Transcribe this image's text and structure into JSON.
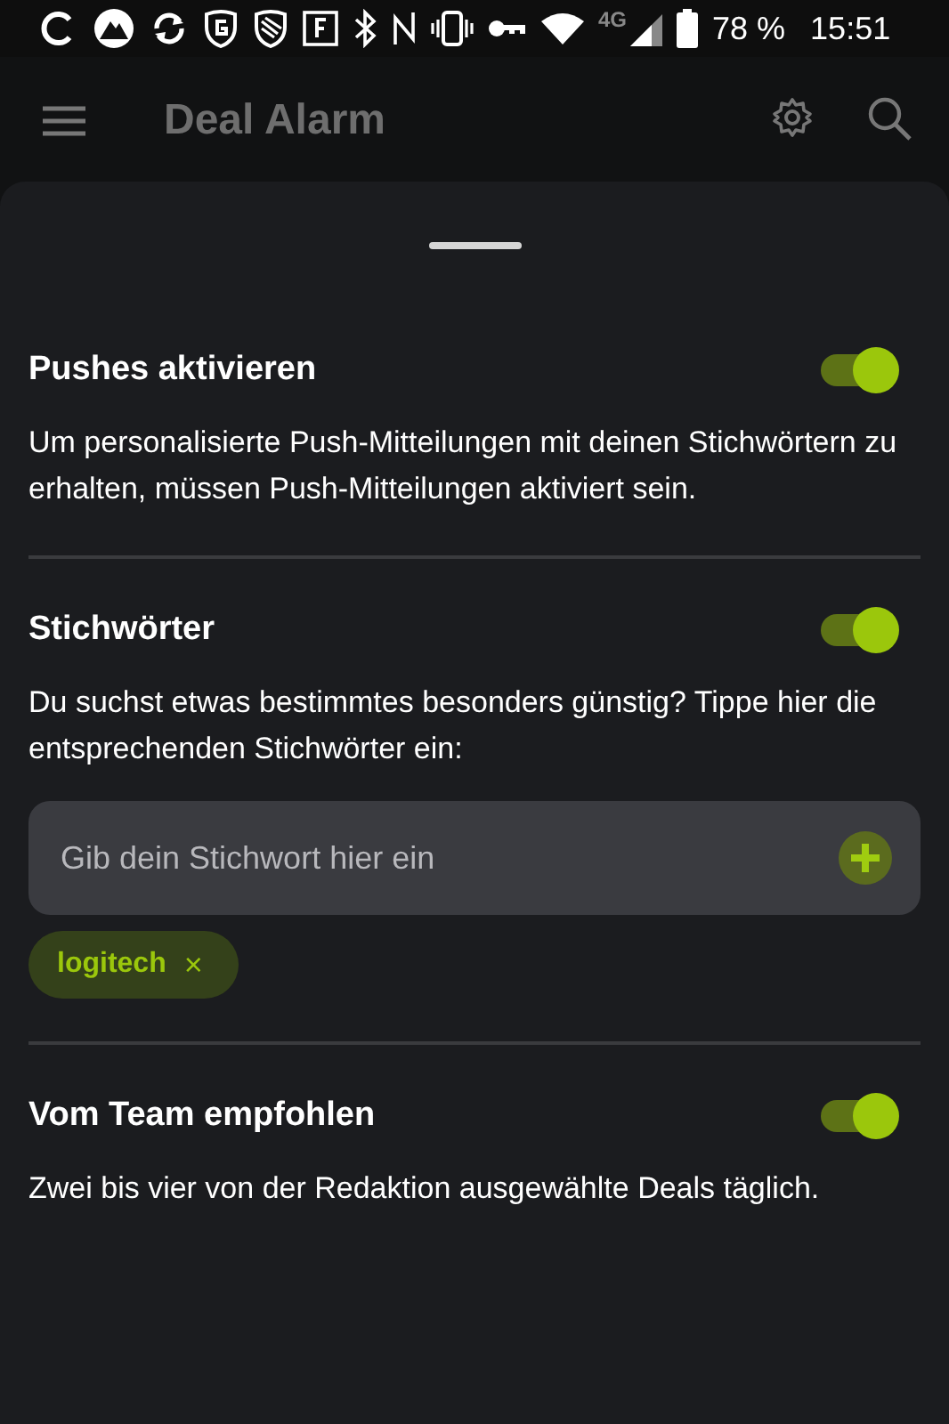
{
  "status_bar": {
    "network": "4G",
    "battery": "78 %",
    "time": "15:51"
  },
  "app_bar": {
    "title": "Deal Alarm"
  },
  "sections": [
    {
      "title": "Pushes aktivieren",
      "on": true,
      "description": "Um personalisierte Push-Mitteilungen mit deinen Stichwörtern zu erhalten, müssen Push-Mitteilungen aktiviert sein."
    },
    {
      "title": "Stichwörter",
      "on": true,
      "description": "Du suchst etwas bestimmtes besonders günstig? Tippe hier die entsprechenden Stichwörter ein:",
      "input": {
        "placeholder": "Gib dein Stichwort hier ein"
      },
      "chips": [
        {
          "label": "logitech",
          "remove": "×"
        }
      ]
    },
    {
      "title": "Vom Team empfohlen",
      "on": true,
      "description": "Zwei bis vier von der Redaktion ausgewählte Deals täglich."
    }
  ]
}
